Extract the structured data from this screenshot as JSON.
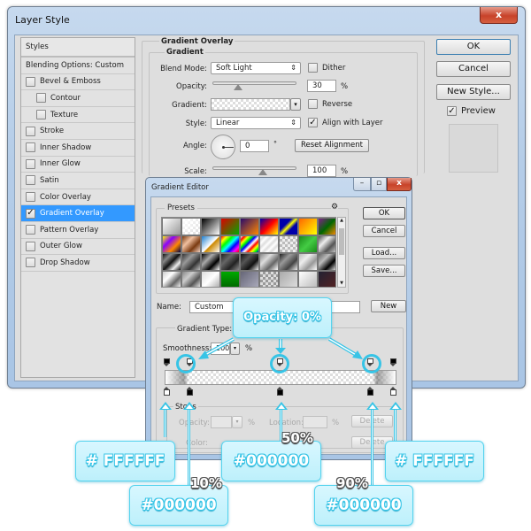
{
  "layer_style": {
    "title": "Layer Style",
    "close_label": "x",
    "styles_header": "Styles",
    "blending_options": "Blending Options: Custom",
    "style_items": [
      {
        "label": "Bevel & Emboss",
        "checked": false,
        "indent": false,
        "selected": false
      },
      {
        "label": "Contour",
        "checked": false,
        "indent": true,
        "selected": false
      },
      {
        "label": "Texture",
        "checked": false,
        "indent": true,
        "selected": false
      },
      {
        "label": "Stroke",
        "checked": false,
        "indent": false,
        "selected": false
      },
      {
        "label": "Inner Shadow",
        "checked": false,
        "indent": false,
        "selected": false
      },
      {
        "label": "Inner Glow",
        "checked": false,
        "indent": false,
        "selected": false
      },
      {
        "label": "Satin",
        "checked": false,
        "indent": false,
        "selected": false
      },
      {
        "label": "Color Overlay",
        "checked": false,
        "indent": false,
        "selected": false
      },
      {
        "label": "Gradient Overlay",
        "checked": true,
        "indent": false,
        "selected": true
      },
      {
        "label": "Pattern Overlay",
        "checked": false,
        "indent": false,
        "selected": false
      },
      {
        "label": "Outer Glow",
        "checked": false,
        "indent": false,
        "selected": false
      },
      {
        "label": "Drop Shadow",
        "checked": false,
        "indent": false,
        "selected": false
      }
    ],
    "section_title": "Gradient Overlay",
    "subsection_title": "Gradient",
    "blend_mode_label": "Blend Mode:",
    "blend_mode_value": "Soft Light",
    "dither_label": "Dither",
    "opacity_label": "Opacity:",
    "opacity_value": "30",
    "opacity_percent": 30,
    "percent_sign": "%",
    "gradient_label": "Gradient:",
    "reverse_label": "Reverse",
    "style_label": "Style:",
    "style_value": "Linear",
    "align_label": "Align with Layer",
    "angle_label": "Angle:",
    "angle_value": "0",
    "degree_sign": "°",
    "reset_alignment": "Reset Alignment",
    "scale_label": "Scale:",
    "scale_value": "100",
    "ok": "OK",
    "cancel": "Cancel",
    "new_style": "New Style...",
    "preview_label": "Preview",
    "preview_checked": true
  },
  "gradient_editor": {
    "title": "Gradient Editor",
    "minimize": "–",
    "restore": "▫",
    "close": "x",
    "presets_label": "Presets",
    "gear": "⚙",
    "ok": "OK",
    "cancel": "Cancel",
    "load": "Load...",
    "save": "Save...",
    "name_label": "Name:",
    "name_value": "Custom",
    "new_label": "New",
    "gradient_type_label": "Gradient Type:",
    "smoothness_label": "Smoothness:",
    "smoothness_value": "100",
    "stops_label": "Stops",
    "stop_opacity_label": "Opacity:",
    "stop_location_label": "Location:",
    "stop_color_label": "Color:",
    "delete_label": "Delete",
    "opacity_stops": [
      {
        "location": 0,
        "opacity": 100
      },
      {
        "location": 10,
        "opacity": 0
      },
      {
        "location": 50,
        "opacity": 0
      },
      {
        "location": 90,
        "opacity": 0
      },
      {
        "location": 100,
        "opacity": 100
      }
    ],
    "color_stops": [
      {
        "location": 0,
        "color": "#FFFFFF"
      },
      {
        "location": 10,
        "color": "#000000"
      },
      {
        "location": 50,
        "color": "#000000"
      },
      {
        "location": 90,
        "color": "#000000"
      },
      {
        "location": 100,
        "color": "#FFFFFF"
      }
    ]
  },
  "annotations": {
    "opacity_callout": "Opacity: 0%",
    "hex_white_left": "# FFFFFF",
    "hex_black_10": "#000000",
    "hex_black_50": "#000000",
    "hex_black_90": "#000000",
    "hex_white_right": "# FFFFFF",
    "pct_10": "10%",
    "pct_50": "50%",
    "pct_90": "90%",
    "accent_color": "#37C4E6"
  }
}
